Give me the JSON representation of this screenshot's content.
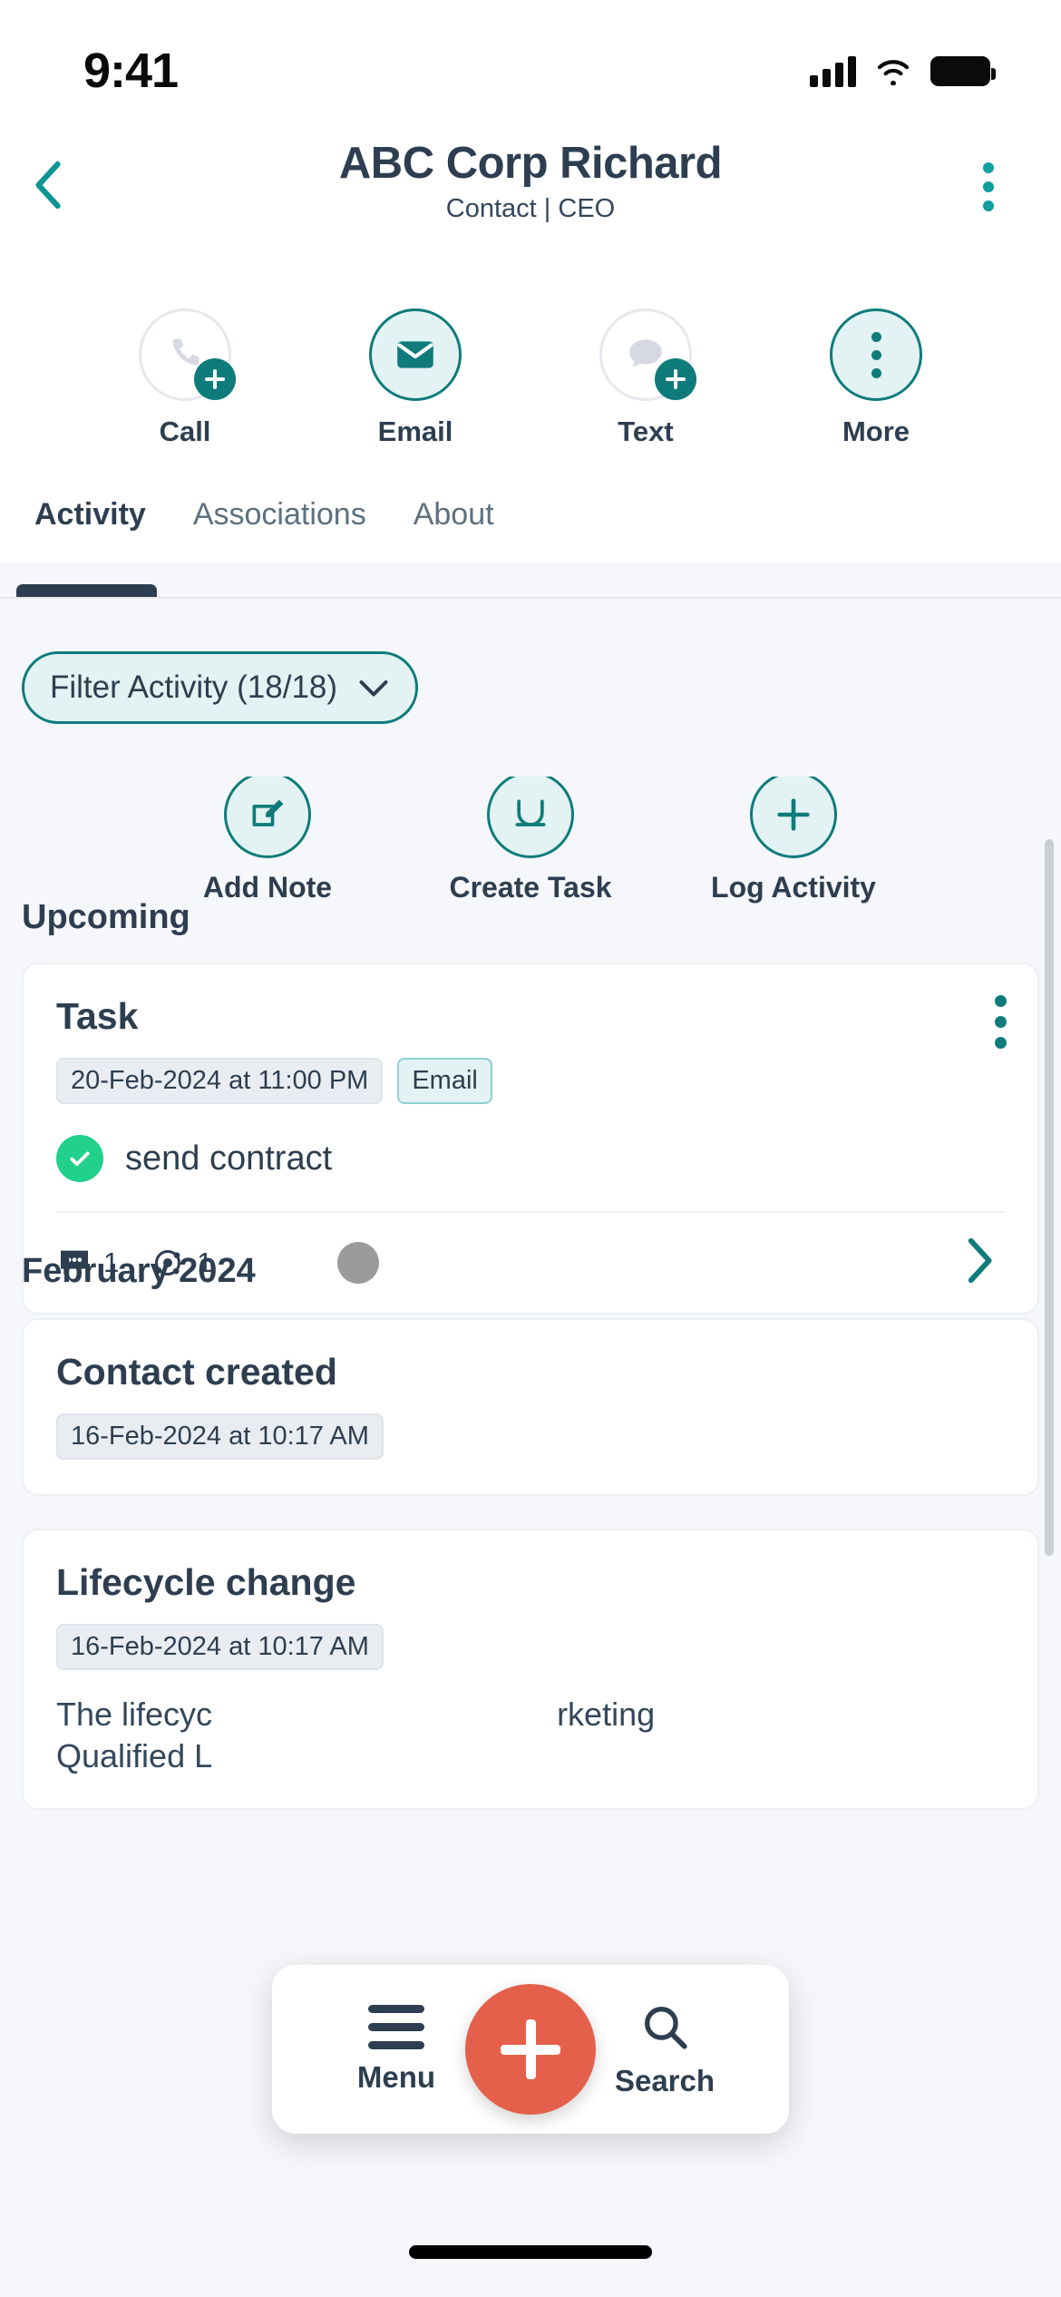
{
  "status_bar": {
    "time": "9:41",
    "icons": [
      "cellular-signal-icon",
      "wifi-icon",
      "battery-icon"
    ]
  },
  "header": {
    "back_icon": "chevron-left-icon",
    "title": "ABC Corp Richard",
    "subtitle": "Contact | CEO",
    "overflow_icon": "kebab-menu-icon"
  },
  "primary_actions": [
    {
      "label": "Call",
      "icon": "phone-icon",
      "state": "inactive",
      "has_plus_badge": true
    },
    {
      "label": "Email",
      "icon": "envelope-icon",
      "state": "active",
      "has_plus_badge": false
    },
    {
      "label": "Text",
      "icon": "chat-bubble-icon",
      "state": "inactive",
      "has_plus_badge": true
    },
    {
      "label": "More",
      "icon": "kebab-menu-icon",
      "state": "active",
      "has_plus_badge": false
    }
  ],
  "tabs": {
    "items": [
      {
        "label": "Activity",
        "selected": true
      },
      {
        "label": "Associations",
        "selected": false
      },
      {
        "label": "About",
        "selected": false
      }
    ]
  },
  "filter": {
    "label": "Filter Activity (18/18)",
    "chevron_icon": "chevron-down-icon"
  },
  "quick_actions": [
    {
      "label": "Add Note",
      "icon": "note-edit-icon"
    },
    {
      "label": "Create Task",
      "icon": "task-icon"
    },
    {
      "label": "Log Activity",
      "icon": "plus-icon"
    }
  ],
  "sections": [
    {
      "heading": "Upcoming",
      "cards": [
        {
          "title": "Task",
          "date": "20-Feb-2024 at 11:00 PM",
          "type": "Email",
          "task_text": "send contract",
          "task_done": true,
          "comment_count": "1",
          "association_count": "1",
          "has_avatar": true,
          "overflow_icon": "kebab-menu-icon",
          "open_icon": "chevron-right-icon"
        }
      ]
    },
    {
      "heading": "February 2024",
      "cards": [
        {
          "title": "Contact created",
          "date": "16-Feb-2024 at 10:17 AM"
        },
        {
          "title": "Lifecycle change",
          "date": "16-Feb-2024 at 10:17 AM",
          "body_line1": "The lifecyc",
          "body_line1_tail": "rketing",
          "body_line2": "Qualified L"
        }
      ]
    }
  ],
  "bottom_bar": {
    "menu_label": "Menu",
    "menu_icon": "hamburger-icon",
    "fab_icon": "plus-icon",
    "search_label": "Search",
    "search_icon": "search-icon"
  },
  "colors": {
    "teal": "#0f7b7b",
    "teal_light_bg": "#e3f2f2",
    "dark_text": "#2d3e50",
    "fab_red": "#e5604a",
    "check_green": "#21d08a",
    "page_bg": "#f5f7fa"
  }
}
